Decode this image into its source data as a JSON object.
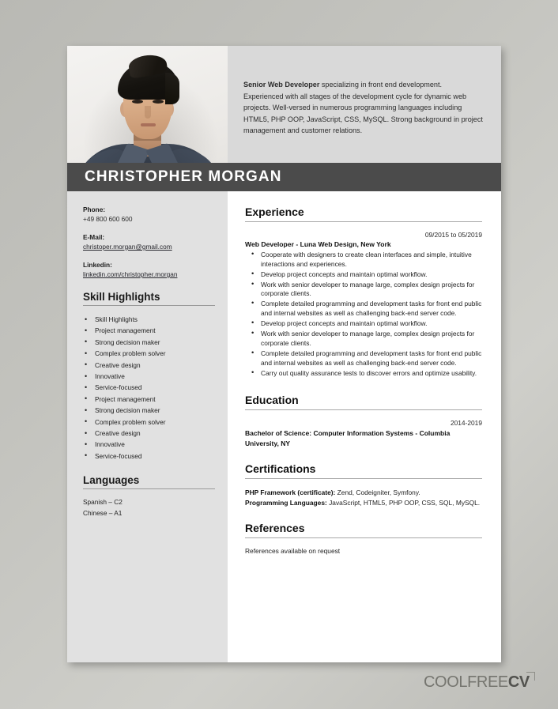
{
  "document": {
    "type": "resume",
    "candidate_name": "CHRISTOPHER MORGAN"
  },
  "summary": {
    "lead": "Senior Web Developer",
    "body": " specializing in front end development. Experienced with all stages of the development cycle for dynamic web projects. Well-versed in numerous programming languages including HTML5, PHP OOP, JavaScript, CSS, MySQL. Strong background in project management and customer relations."
  },
  "contact": {
    "phone_label": "Phone:",
    "phone_value": "+49 800 600 600",
    "email_label": "E-Mail:",
    "email_value": "christoper.morgan@gmail.com",
    "linkedin_label": "Linkedin:",
    "linkedin_value": "linkedin.com/christopher.morgan"
  },
  "skills": {
    "heading": "Skill Highlights",
    "items": [
      "Skill Highlights",
      "Project management",
      "Strong decision maker",
      "Complex problem solver",
      "Creative design",
      "Innovative",
      "Service-focused",
      "Project management",
      "Strong decision maker",
      "Complex problem solver",
      "Creative design",
      "Innovative",
      "Service-focused"
    ]
  },
  "languages": {
    "heading": "Languages",
    "items": [
      "Spanish – C2",
      "Chinese – A1"
    ]
  },
  "experience": {
    "heading": "Experience",
    "date": "09/2015 to 05/2019",
    "title": "Web Developer -  Luna Web Design, New York",
    "bullets": [
      "Cooperate with designers to create clean interfaces and simple, intuitive interactions and experiences.",
      "Develop project concepts and maintain optimal workflow.",
      "Work with senior developer to manage large, complex design projects for corporate clients.",
      "Complete detailed programming and development tasks for front end public and internal websites as well as challenging back-end server code.",
      "Develop project concepts and maintain optimal workflow.",
      "Work with senior developer to manage large, complex design projects for corporate clients.",
      "Complete detailed programming and development tasks for front end public and internal websites as well as challenging back-end server code.",
      "Carry out quality assurance tests to discover errors and optimize usability."
    ]
  },
  "education": {
    "heading": "Education",
    "date": "2014-2019",
    "degree": "Bachelor of Science: Computer Information Systems - Columbia University, NY"
  },
  "certifications": {
    "heading": "Certifications",
    "line1_label": "PHP Framework (certificate):",
    "line1_value": " Zend, Codeigniter, Symfony.",
    "line2_label": "Programming Languages:",
    "line2_value": " JavaScript, HTML5, PHP OOP, CSS, SQL, MySQL."
  },
  "references": {
    "heading": "References",
    "text": "References available on request"
  },
  "watermark": {
    "light": "COOLFREE",
    "bold": "CV"
  },
  "colors": {
    "name_bar": "#4b4b4b",
    "summary_bg": "#d9d9d9",
    "sidebar_bg": "#e1e1e1",
    "page_bg": "#ffffff"
  }
}
